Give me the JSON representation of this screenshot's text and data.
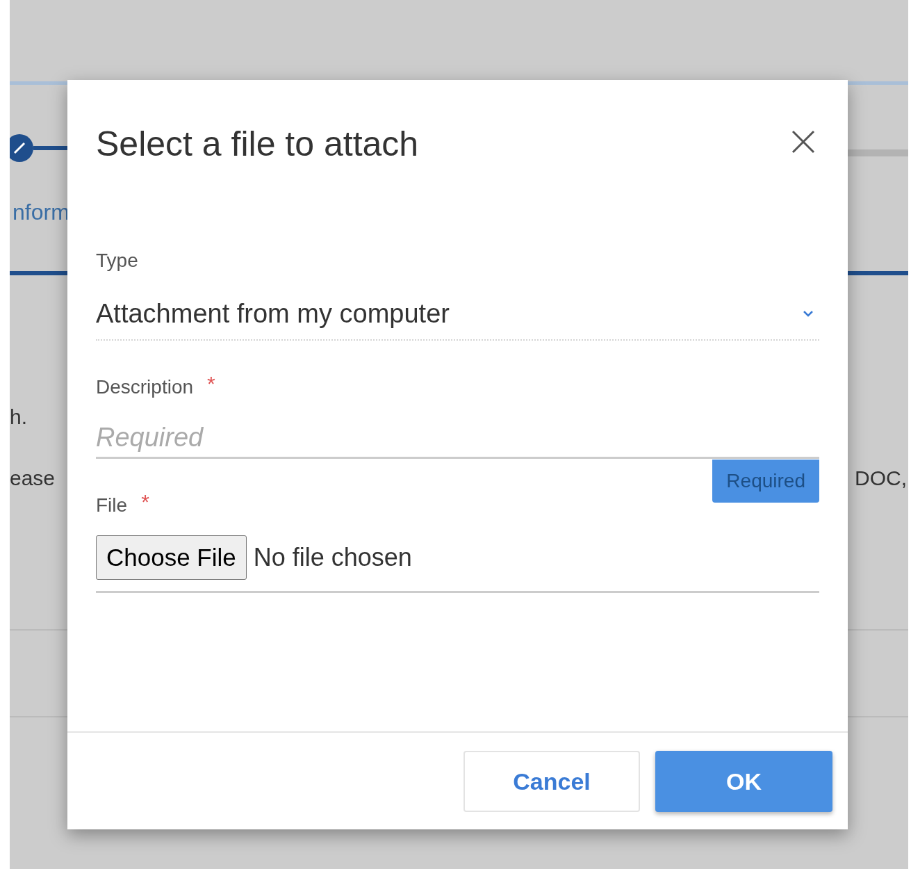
{
  "background": {
    "step_label": "nform",
    "texts_left": [
      "h.",
      "ease"
    ],
    "text_right": "DOC,"
  },
  "dialog": {
    "title": "Select a file to attach",
    "fields": [
      {
        "kind": "select",
        "label": "Type",
        "value": "Attachment from my computer"
      },
      {
        "kind": "text",
        "label": "Description",
        "required_mark": "*",
        "placeholder": "Required",
        "error": "Required"
      },
      {
        "kind": "file",
        "label": "File",
        "required_mark": "*",
        "button": "Choose File",
        "status": "No file chosen"
      }
    ],
    "buttons": [
      {
        "label": "Cancel",
        "primary": false
      },
      {
        "label": "OK",
        "primary": true
      }
    ]
  }
}
